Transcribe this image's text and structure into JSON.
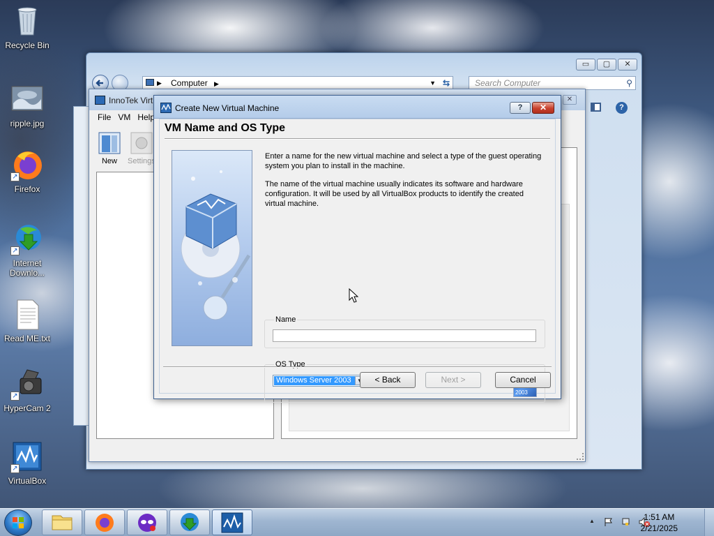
{
  "desktop": {
    "icons": [
      {
        "label": "Recycle Bin"
      },
      {
        "label": "ripple.jpg"
      },
      {
        "label": "Firefox"
      },
      {
        "label": "Internet Downlo..."
      },
      {
        "label": "Read ME.txt"
      },
      {
        "label": "HyperCam 2"
      },
      {
        "label": "VirtualBox"
      }
    ]
  },
  "explorer": {
    "address": "Computer",
    "search_placeholder": "Search Computer",
    "buttons": {
      "minimize": "▭",
      "maximize": "▢",
      "close": "✕"
    }
  },
  "vbox": {
    "title": "InnoTek Virt",
    "menu": [
      "File",
      "VM",
      "Help"
    ],
    "toolbar": [
      {
        "label": "New"
      },
      {
        "label": "Settings"
      }
    ]
  },
  "wizard": {
    "title": "Create New Virtual Machine",
    "heading": "VM Name and OS Type",
    "help_label": "?",
    "close_label": "✕",
    "paragraph1": "Enter a name for the new virtual machine and select a type of the guest operating system you plan to install in the machine.",
    "paragraph2": "The name of the virtual machine usually indicates its software and hardware configuration. It will be used by all VirtualBox products to identify the created virtual machine.",
    "name_group_label": "Name",
    "name_value": "",
    "os_group_label": "OS Type",
    "os_selected": "Windows Server 2003",
    "os_logo_text": "2003",
    "back_label": "< Back",
    "next_label": "Next >",
    "cancel_label": "Cancel"
  },
  "taskbar": {
    "time": "1:51 AM",
    "date": "2/21/2025",
    "tray_arrow": "▲"
  }
}
